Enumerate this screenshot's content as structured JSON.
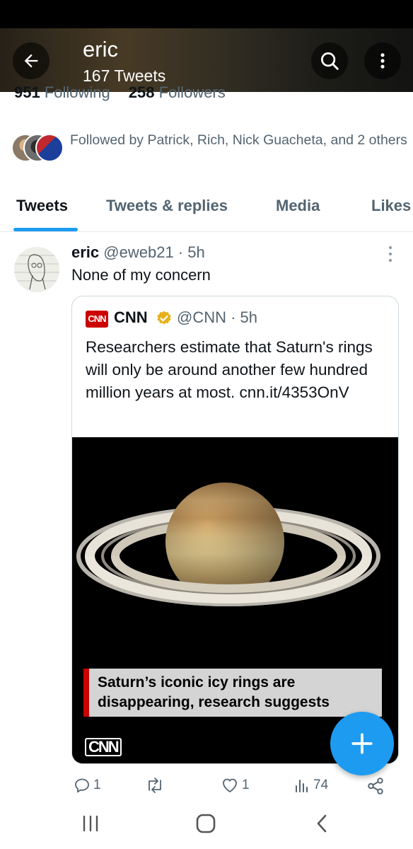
{
  "header": {
    "name": "eric",
    "tweet_count": "167 Tweets",
    "back_icon": "arrow-left-icon",
    "search_icon": "search-icon",
    "more_icon": "more-vertical-icon"
  },
  "profile": {
    "following_count": "951",
    "following_label": "Following",
    "followers_count": "258",
    "followers_label": "Followers",
    "followed_by": "Followed by Patrick, Rich, Nick Guacheta, and 2 others"
  },
  "tabs": [
    {
      "label": "Tweets",
      "active": true
    },
    {
      "label": "Tweets & replies",
      "active": false
    },
    {
      "label": "Media",
      "active": false
    },
    {
      "label": "Likes",
      "active": false
    }
  ],
  "tweet": {
    "author": "eric",
    "handle_time": "@eweb21 · 5h",
    "text": "None of my concern",
    "quote": {
      "logo_text": "CNN",
      "name": "CNN",
      "handle_time": "@CNN · 5h",
      "text": "Researchers estimate that Saturn's rings will only be around another few hundred million years at most. cnn.it/4353OnV",
      "media_caption": "Saturn’s iconic icy rings are disappearing, research suggests",
      "media_logo": "CNN"
    },
    "actions": {
      "reply_count": "1",
      "retweet_count": "",
      "like_count": "1",
      "view_count": "74"
    }
  },
  "colors": {
    "accent": "#1d9bf0",
    "cnn_red": "#cc0000",
    "verified_gold": "#e8b017"
  }
}
